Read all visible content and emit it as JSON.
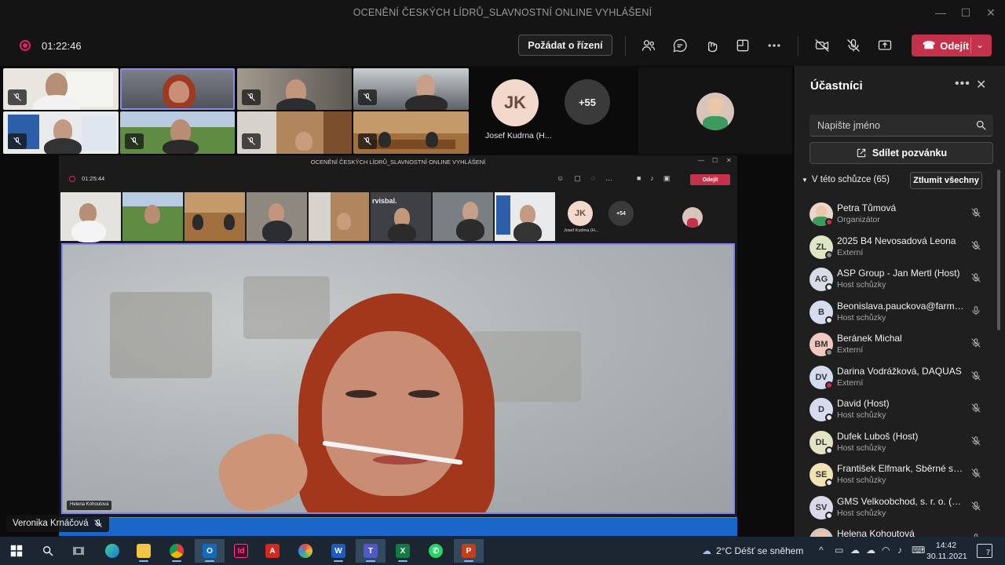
{
  "window": {
    "title": "OCENĚNÍ ČESKÝCH LÍDRŮ_SLAVNOSTNÍ ONLINE VYHLÁŠENÍ",
    "min": "—",
    "max": "☐",
    "close": "✕"
  },
  "toolbar": {
    "timer": "01:22:46",
    "request_control": "Požádat o řízení",
    "leave": "Odejít"
  },
  "gallery": {
    "avatar_initials": "JK",
    "avatar_name": "Josef Kudrna (H...",
    "overflow_count": "+55"
  },
  "nested": {
    "title": "OCENĚNÍ ČESKÝCH LÍDRŮ_SLAVNOSTNÍ ONLINE VYHLÁŠENÍ",
    "timer": "01:25:44",
    "leave": "Odejít",
    "avatar_initials": "JK",
    "avatar_name": "Josef Kudrna (H...",
    "overflow_count": "+54",
    "speaker_label": "Helena Kohoutová",
    "brand_text": "rvisbal."
  },
  "presenter": {
    "name": "Veronika Krnáčová"
  },
  "panel": {
    "title": "Účastníci",
    "search_placeholder": "Napište jméno",
    "invite": "Sdílet pozvánku",
    "section": "V této schůzce (65)",
    "mute_all": "Ztlumit všechny",
    "participants": [
      {
        "name": "Petra Tůmová",
        "role": "Organizátor",
        "initials": "",
        "avatar_color": "#e9d7c9",
        "status": "#c4314b",
        "mic": "off"
      },
      {
        "name": "2025 B4 Nevosadová Leona",
        "role": "Externí",
        "initials": "ZL",
        "avatar_color": "#dfe6c5",
        "status": "#8a8a8a",
        "mic": "off"
      },
      {
        "name": "ASP Group - Jan Mertl (Host)",
        "role": "Host schůzky",
        "initials": "AG",
        "avatar_color": "#d6dde6",
        "status": "#e6e6e6",
        "mic": "off"
      },
      {
        "name": "Beonislava.pauckova@farmak...",
        "role": "Host schůzky",
        "initials": "B",
        "avatar_color": "#d6dbef",
        "status": "#e6e6e6",
        "mic": "on"
      },
      {
        "name": "Beránek Michal",
        "role": "Externí",
        "initials": "BM",
        "avatar_color": "#f2c8c0",
        "status": "#8a8a8a",
        "mic": "off"
      },
      {
        "name": "Darina Vodrážková, DAQUAS",
        "role": "Externí",
        "initials": "DV",
        "avatar_color": "#d3dcef",
        "status": "#c4314b",
        "mic": "off"
      },
      {
        "name": "David (Host)",
        "role": "Host schůzky",
        "initials": "D",
        "avatar_color": "#d6dbef",
        "status": "#e6e6e6",
        "mic": "off"
      },
      {
        "name": "Dufek Luboš (Host)",
        "role": "Host schůzky",
        "initials": "DL",
        "avatar_color": "#e6e2c4",
        "status": "#e6e6e6",
        "mic": "off"
      },
      {
        "name": "František Elfmark, Sběrné sur...",
        "role": "Host schůzky",
        "initials": "SE",
        "avatar_color": "#f1e3b6",
        "status": "#e6e6e6",
        "mic": "off"
      },
      {
        "name": "GMS Velkoobchod, s. r. o. (Ho...",
        "role": "Host schůzky",
        "initials": "SV",
        "avatar_color": "#dcd8ec",
        "status": "#e6e6e6",
        "mic": "off"
      },
      {
        "name": "Helena Kohoutová",
        "role": "",
        "initials": "",
        "avatar_color": "#d8c4b8",
        "status": "",
        "mic": "on"
      }
    ]
  },
  "taskbar": {
    "weather": "2°C  Déšť se sněhem",
    "time": "14:42",
    "date": "30.11.2021",
    "notifications": "7",
    "apps": [
      "Windows",
      "Search",
      "Task View",
      "Edge",
      "File Explorer",
      "Chrome",
      "Outlook",
      "InDesign",
      "Acrobat",
      "Paint",
      "Word",
      "Teams",
      "Excel",
      "WhatsApp",
      "PowerPoint"
    ]
  },
  "colors": {
    "accent": "#7f85f5",
    "leave": "#c4314b",
    "recording": "#e0245e",
    "taskbar": "#1c2633"
  }
}
